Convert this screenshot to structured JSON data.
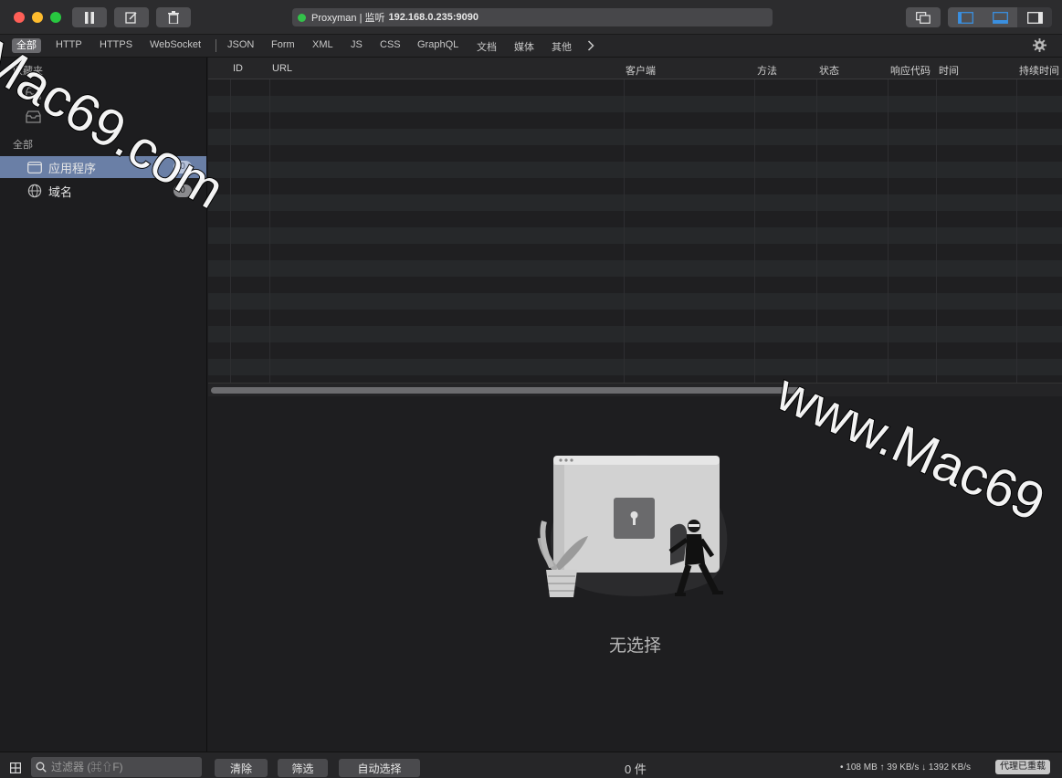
{
  "titlebar": {
    "app_name": "Proxyman | 监听",
    "host": "192.168.0.235:9090"
  },
  "tabs": [
    "全部",
    "HTTP",
    "HTTPS",
    "WebSocket",
    "JSON",
    "Form",
    "XML",
    "JS",
    "CSS",
    "GraphQL",
    "文档",
    "媒体",
    "其他"
  ],
  "sidebar": {
    "favorites_header": "收藏夹",
    "all_header": "全部",
    "items": [
      {
        "label": "应用程序",
        "count": "0"
      },
      {
        "label": "域名",
        "count": "0"
      }
    ]
  },
  "table": {
    "columns": [
      "ID",
      "URL",
      "客户端",
      "方法",
      "状态",
      "响应代码",
      "时间",
      "持续时间"
    ]
  },
  "detail": {
    "empty_label": "无选择"
  },
  "bottombar": {
    "filter_placeholder": "过滤器 (⌘⇧F)",
    "clear_label": "清除",
    "filter_label": "筛选",
    "autoselect_label": "自动选择",
    "count_label": "0 件",
    "stats": "• 108 MB ↑ 39 KB/s ↓ 1392 KB/s",
    "proxy_status": "代理已重载"
  },
  "watermark": {
    "text1": "Mac69.com",
    "text2": "www.Mac69"
  },
  "colors": {
    "accent_selection": "#6a7fa6",
    "status_dot": "#33c24a",
    "layout_icon_blue": "#3a8fe0"
  }
}
